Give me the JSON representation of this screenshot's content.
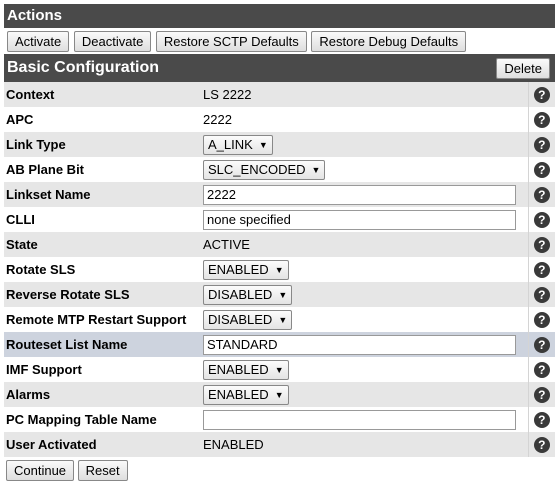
{
  "actions": {
    "title": "Actions",
    "buttons": [
      "Activate",
      "Deactivate",
      "Restore SCTP Defaults",
      "Restore Debug Defaults"
    ]
  },
  "basic": {
    "title": "Basic Configuration",
    "delete_label": "Delete"
  },
  "rows": {
    "context": {
      "label": "Context",
      "value": "LS 2222"
    },
    "apc": {
      "label": "APC",
      "value": "2222"
    },
    "link_type": {
      "label": "Link Type",
      "value": "A_LINK"
    },
    "ab_plane_bit": {
      "label": "AB Plane Bit",
      "value": "SLC_ENCODED"
    },
    "linkset_name": {
      "label": "Linkset Name",
      "value": "2222"
    },
    "clli": {
      "label": "CLLI",
      "value": "none specified"
    },
    "state": {
      "label": "State",
      "value": "ACTIVE"
    },
    "rotate_sls": {
      "label": "Rotate SLS",
      "value": "ENABLED"
    },
    "reverse_rotate_sls": {
      "label": "Reverse Rotate SLS",
      "value": "DISABLED"
    },
    "remote_mtp_restart": {
      "label": "Remote MTP Restart Support",
      "value": "DISABLED"
    },
    "routeset_list_name": {
      "label": "Routeset List Name",
      "value": "STANDARD"
    },
    "imf_support": {
      "label": "IMF Support",
      "value": "ENABLED"
    },
    "alarms": {
      "label": "Alarms",
      "value": "ENABLED"
    },
    "pc_mapping_table": {
      "label": "PC Mapping Table Name",
      "value": ""
    },
    "user_activated": {
      "label": "User Activated",
      "value": "ENABLED"
    }
  },
  "help_glyph": "?",
  "dropdown_arrow": "▼",
  "footer": {
    "continue_label": "Continue",
    "reset_label": "Reset"
  }
}
